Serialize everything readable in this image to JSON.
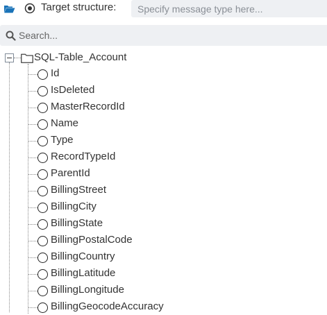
{
  "toolbar": {
    "target_label": "Target structure:",
    "message_type_placeholder": "Specify message type here..."
  },
  "search": {
    "placeholder": "Search..."
  },
  "tree": {
    "root": "SQL-Table_Account",
    "fields": [
      "Id",
      "IsDeleted",
      "MasterRecordId",
      "Name",
      "Type",
      "RecordTypeId",
      "ParentId",
      "BillingStreet",
      "BillingCity",
      "BillingState",
      "BillingPostalCode",
      "BillingCountry",
      "BillingLatitude",
      "BillingLongitude",
      "BillingGeocodeAccuracy"
    ]
  },
  "colors": {
    "accent": "#1a73b8",
    "input_bg": "#eef0f3"
  }
}
